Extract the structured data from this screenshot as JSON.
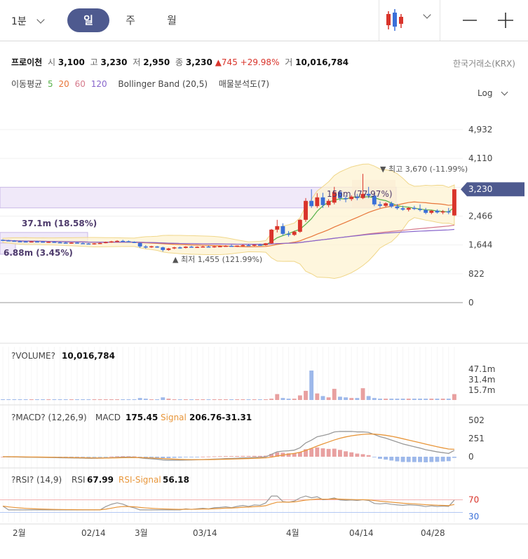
{
  "toolbar": {
    "interval": "1분",
    "periods": [
      {
        "label": "일",
        "active": true
      },
      {
        "label": "주",
        "active": false
      },
      {
        "label": "월",
        "active": false
      }
    ],
    "chart_type_icon": "candlestick-icon",
    "minus_icon": "minus-icon",
    "plus_icon": "plus-icon"
  },
  "quote": {
    "name": "프로이천",
    "open_label": "시",
    "open": "3,100",
    "high_label": "고",
    "high": "3,230",
    "low_label": "저",
    "low": "2,950",
    "close_label": "종",
    "close": "3,230",
    "change": "745",
    "change_pct": "+29.98%",
    "volume_label": "거",
    "volume": "10,016,784",
    "exchange": "한국거래소(KRX)",
    "up_color": "#d9342b"
  },
  "indicators": {
    "ma_label": "이동평균",
    "ma": [
      {
        "period": "5",
        "color": "#55b047"
      },
      {
        "period": "20",
        "color": "#e8763a"
      },
      {
        "period": "60",
        "color": "#d67a8c"
      },
      {
        "period": "120",
        "color": "#8866cc"
      }
    ],
    "bollinger": "Bollinger Band (20,5)",
    "volume_profile": "매물분석도(7)"
  },
  "scale": {
    "label": "Log"
  },
  "chart_data": [
    {
      "type": "candlestick",
      "price_axis_ticks": [
        "4,932",
        "4,110",
        "3,288",
        "2,466",
        "1,644",
        "822",
        "0"
      ],
      "price_axis_values": [
        4932,
        4110,
        3288,
        2466,
        1644,
        822,
        0
      ],
      "current_price": "3,230",
      "x_tick_labels": [
        "2월",
        "02/14",
        "3월",
        "03/14",
        "4월",
        "04/14",
        "04/28"
      ],
      "annotations": {
        "high": "최고 3,670 (-11.99%)",
        "low": "최저 1,455 (121.99%)",
        "profile_top": "156m (77.97%)",
        "profile_mid": "37.1m (18.58%)",
        "profile_low": "6.88m (3.45%)"
      },
      "candles": [
        [
          1790,
          1800,
          1760,
          1775
        ],
        [
          1775,
          1790,
          1750,
          1765
        ],
        [
          1765,
          1780,
          1740,
          1750
        ],
        [
          1750,
          1770,
          1730,
          1745
        ],
        [
          1745,
          1760,
          1720,
          1735
        ],
        [
          1735,
          1755,
          1715,
          1745
        ],
        [
          1745,
          1765,
          1725,
          1740
        ],
        [
          1740,
          1755,
          1715,
          1725
        ],
        [
          1725,
          1745,
          1705,
          1735
        ],
        [
          1735,
          1750,
          1710,
          1720
        ],
        [
          1720,
          1740,
          1700,
          1710
        ],
        [
          1710,
          1730,
          1690,
          1700
        ],
        [
          1700,
          1720,
          1680,
          1710
        ],
        [
          1710,
          1725,
          1685,
          1695
        ],
        [
          1695,
          1715,
          1675,
          1685
        ],
        [
          1685,
          1700,
          1665,
          1675
        ],
        [
          1675,
          1695,
          1655,
          1690
        ],
        [
          1690,
          1710,
          1670,
          1700
        ],
        [
          1700,
          1740,
          1690,
          1725
        ],
        [
          1725,
          1760,
          1705,
          1745
        ],
        [
          1745,
          1780,
          1725,
          1760
        ],
        [
          1760,
          1790,
          1735,
          1750
        ],
        [
          1750,
          1770,
          1720,
          1730
        ],
        [
          1730,
          1745,
          1700,
          1715
        ],
        [
          1700,
          1710,
          1560,
          1600
        ],
        [
          1600,
          1640,
          1540,
          1580
        ],
        [
          1580,
          1620,
          1560,
          1605
        ],
        [
          1600,
          1615,
          1560,
          1575
        ],
        [
          1575,
          1595,
          1455,
          1500
        ],
        [
          1500,
          1560,
          1480,
          1545
        ],
        [
          1545,
          1590,
          1525,
          1575
        ],
        [
          1575,
          1600,
          1540,
          1560
        ],
        [
          1560,
          1610,
          1545,
          1595
        ],
        [
          1595,
          1620,
          1565,
          1580
        ],
        [
          1580,
          1605,
          1560,
          1590
        ],
        [
          1590,
          1620,
          1570,
          1600
        ],
        [
          1600,
          1625,
          1575,
          1585
        ],
        [
          1585,
          1615,
          1565,
          1605
        ],
        [
          1605,
          1630,
          1585,
          1610
        ],
        [
          1610,
          1640,
          1590,
          1620
        ],
        [
          1620,
          1650,
          1600,
          1605
        ],
        [
          1605,
          1630,
          1585,
          1625
        ],
        [
          1625,
          1660,
          1605,
          1640
        ],
        [
          1640,
          1670,
          1615,
          1625
        ],
        [
          1625,
          1655,
          1605,
          1650
        ],
        [
          1650,
          1680,
          1630,
          1645
        ],
        [
          1640,
          1700,
          1620,
          1690
        ],
        [
          1690,
          2100,
          1680,
          2080
        ],
        [
          2080,
          2360,
          2000,
          2180
        ],
        [
          2180,
          2260,
          1920,
          1960
        ],
        [
          1960,
          2040,
          1880,
          1930
        ],
        [
          1930,
          2050,
          1900,
          2020
        ],
        [
          2020,
          2380,
          1990,
          2360
        ],
        [
          2360,
          2980,
          2300,
          2900
        ],
        [
          2900,
          3230,
          2700,
          2750
        ],
        [
          2750,
          3120,
          2700,
          3000
        ],
        [
          3000,
          3130,
          2700,
          2780
        ],
        [
          2780,
          2950,
          2720,
          2900
        ],
        [
          2850,
          3300,
          2800,
          3150
        ],
        [
          3150,
          3210,
          2900,
          2980
        ],
        [
          2980,
          3060,
          2860,
          2950
        ],
        [
          2950,
          3060,
          2900,
          3020
        ],
        [
          3020,
          3100,
          2920,
          2980
        ],
        [
          2980,
          3670,
          2950,
          3100
        ],
        [
          3100,
          3300,
          2980,
          3050
        ],
        [
          3050,
          3150,
          2750,
          2800
        ],
        [
          2800,
          2880,
          2700,
          2760
        ],
        [
          2760,
          2860,
          2720,
          2830
        ],
        [
          2830,
          2880,
          2700,
          2740
        ],
        [
          2740,
          2810,
          2650,
          2690
        ],
        [
          2690,
          2760,
          2620,
          2650
        ],
        [
          2650,
          2720,
          2600,
          2700
        ],
        [
          2700,
          2760,
          2640,
          2670
        ],
        [
          2670,
          2800,
          2600,
          2640
        ],
        [
          2640,
          2700,
          2520,
          2560
        ],
        [
          2560,
          2640,
          2520,
          2620
        ],
        [
          2620,
          2660,
          2540,
          2570
        ],
        [
          2570,
          2640,
          2520,
          2600
        ],
        [
          2600,
          2700,
          2520,
          2580
        ],
        [
          2485,
          3230,
          2470,
          3230
        ]
      ],
      "volume": {
        "label": "?VOLUME?",
        "value": "10,016,784",
        "ticks": [
          "47.1m",
          "31.4m",
          "15.7m"
        ],
        "bars": [
          1,
          1,
          1,
          1,
          1,
          1,
          1,
          1,
          1,
          1,
          1,
          1,
          1,
          1,
          1,
          1,
          1,
          1,
          1,
          1,
          1,
          1,
          1,
          1,
          3,
          2,
          1,
          1,
          4,
          2,
          1,
          1,
          1,
          1,
          1,
          1,
          1,
          1,
          1,
          1,
          1,
          1,
          1,
          1,
          1,
          1,
          1,
          2,
          9,
          3,
          2,
          2,
          7,
          14,
          45,
          10,
          6,
          4,
          17,
          5,
          4,
          3,
          3,
          18,
          6,
          3,
          2,
          2,
          2,
          2,
          2,
          2,
          2,
          2,
          2,
          2,
          2,
          2,
          2,
          9
        ]
      },
      "macd": {
        "label": "?MACD? (12,26,9)",
        "macd_label": "MACD",
        "macd_value": "175.45",
        "signal_label": "Signal",
        "signal_value": "206.76-31.31",
        "ticks": [
          "502",
          "251",
          "0"
        ]
      },
      "rsi": {
        "label": "?RSI? (14,9)",
        "rsi_label": "RSI",
        "rsi_value": "67.99",
        "signal_label": "RSI-Signal",
        "signal_value": "56.18",
        "ticks": [
          "70",
          "30"
        ]
      }
    }
  ]
}
